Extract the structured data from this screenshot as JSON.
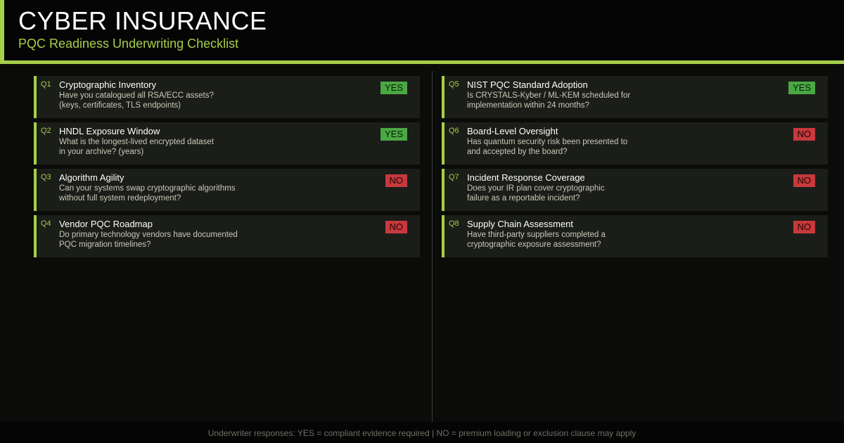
{
  "header": {
    "title": "CYBER INSURANCE",
    "subtitle": "PQC Readiness Underwriting Checklist"
  },
  "colors": {
    "accent": "#a6cf4a",
    "yes": "#4aa843",
    "no": "#c8393d"
  },
  "left_items": [
    {
      "num": "Q1",
      "title": "Cryptographic Inventory",
      "desc": "Have you catalogued all RSA/ECC assets?\n(keys, certificates, TLS endpoints)",
      "answer": "YES"
    },
    {
      "num": "Q2",
      "title": "HNDL Exposure Window",
      "desc": "What is the longest-lived encrypted dataset\nin your archive? (years)",
      "answer": "YES"
    },
    {
      "num": "Q3",
      "title": "Algorithm Agility",
      "desc": "Can your systems swap cryptographic algorithms\nwithout full system redeployment?",
      "answer": "NO"
    },
    {
      "num": "Q4",
      "title": "Vendor PQC Roadmap",
      "desc": "Do primary technology vendors have documented\nPQC migration timelines?",
      "answer": "NO"
    }
  ],
  "right_items": [
    {
      "num": "Q5",
      "title": "NIST PQC Standard Adoption",
      "desc": "Is CRYSTALS-Kyber / ML-KEM scheduled for\nimplementation within 24 months?",
      "answer": "YES"
    },
    {
      "num": "Q6",
      "title": "Board-Level Oversight",
      "desc": "Has quantum security risk been presented to\nand accepted by the board?",
      "answer": "NO"
    },
    {
      "num": "Q7",
      "title": "Incident Response Coverage",
      "desc": "Does your IR plan cover cryptographic\nfailure as a reportable incident?",
      "answer": "NO"
    },
    {
      "num": "Q8",
      "title": "Supply Chain Assessment",
      "desc": "Have third-party suppliers completed a\ncryptographic exposure assessment?",
      "answer": "NO"
    }
  ],
  "footer": {
    "text": "Underwriter responses: YES = compliant evidence required  |  NO = premium loading or exclusion clause may apply"
  }
}
